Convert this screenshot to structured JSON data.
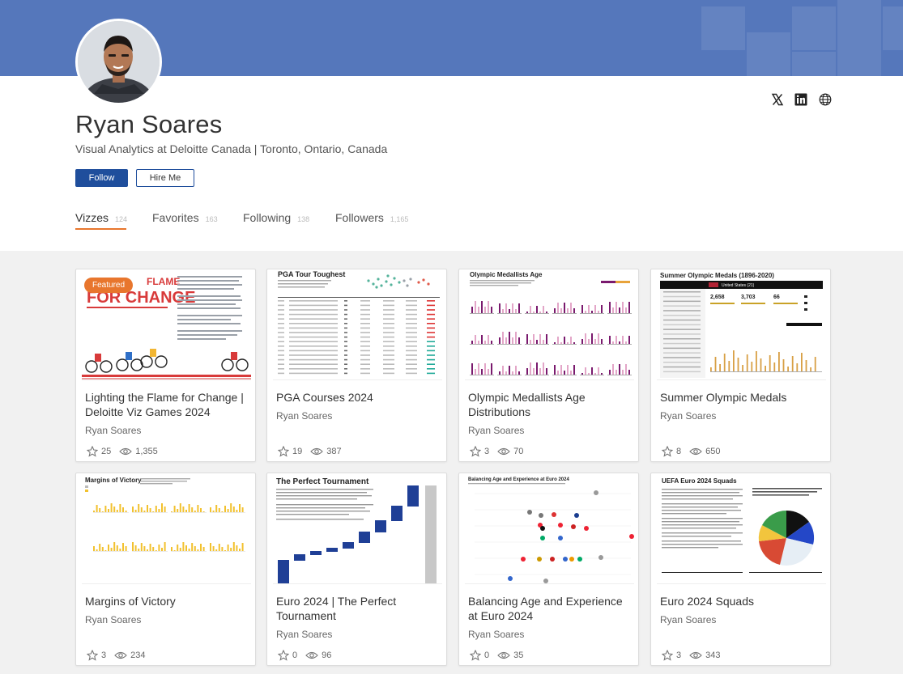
{
  "profile": {
    "name": "Ryan Soares",
    "bio": "Visual Analytics at Deloitte Canada | Toronto, Ontario, Canada",
    "follow_label": "Follow",
    "hire_label": "Hire Me"
  },
  "social": [
    {
      "icon": "x-icon"
    },
    {
      "icon": "linkedin-icon"
    },
    {
      "icon": "globe-icon"
    }
  ],
  "tabs": [
    {
      "label": "Vizzes",
      "count": "124"
    },
    {
      "label": "Favorites",
      "count": "163"
    },
    {
      "label": "Following",
      "count": "138"
    },
    {
      "label": "Followers",
      "count": "1,165"
    }
  ],
  "featured_label": "Featured",
  "cards": [
    {
      "title": "Lighting the Flame for Change | Deloitte Viz Games 2024",
      "author": "Ryan Soares",
      "favorites": "25",
      "views": "1,355"
    },
    {
      "title": "PGA Courses 2024",
      "author": "Ryan Soares",
      "favorites": "19",
      "views": "387"
    },
    {
      "title": "Olympic Medallists Age Distributions",
      "author": "Ryan Soares",
      "favorites": "3",
      "views": "70"
    },
    {
      "title": "Summer Olympic Medals",
      "author": "Ryan Soares",
      "favorites": "8",
      "views": "650"
    },
    {
      "title": "Margins of Victory",
      "author": "Ryan Soares",
      "favorites": "3",
      "views": "234"
    },
    {
      "title": "Euro 2024 | The Perfect Tournament",
      "author": "Ryan Soares",
      "favorites": "0",
      "views": "96"
    },
    {
      "title": "Balancing Age and Experience at Euro 2024",
      "author": "Ryan Soares",
      "favorites": "0",
      "views": "35"
    },
    {
      "title": "Euro 2024 Squads",
      "author": "Ryan Soares",
      "favorites": "3",
      "views": "343"
    }
  ],
  "thumbnails": {
    "flame_heading": "FOR CHANGE",
    "flame_word": "FLAME",
    "pga_title": "PGA Tour Toughest",
    "olympic_title": "Olympic Medallists Age",
    "summer_title": "Summer Olympic Medals (1896-2020)",
    "summer_country": "United States (21)",
    "summer_stats": [
      "2,658",
      "3,703",
      "66"
    ],
    "margins_title": "Margins of Victory",
    "perfect_title": "The Perfect Tournament",
    "balancing_title": "Balancing Age and Experience at Euro 2024",
    "squads_title": "UEFA Euro 2024 Squads"
  },
  "colors": {
    "banner": "#5577bb",
    "primary_button": "#1f4e9c",
    "accent": "#e8762d"
  }
}
